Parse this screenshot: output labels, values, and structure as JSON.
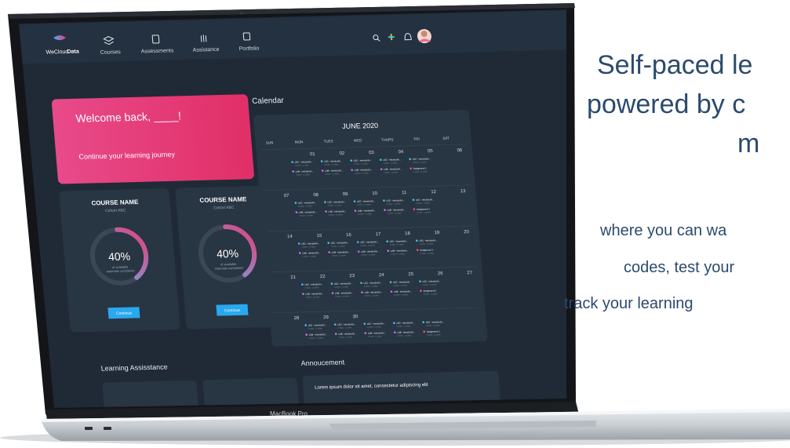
{
  "marketing": {
    "headline": [
      "Self-paced le",
      "powered by c",
      "m"
    ],
    "body": [
      "where you can wa",
      "codes, test your",
      "track your learning"
    ]
  },
  "laptop": {
    "brand_label": "MacBook Pro"
  },
  "app": {
    "logo": {
      "prefix": "WeCloud",
      "suffix": "Data"
    },
    "nav": [
      {
        "label": "Courses",
        "icon": "layers-icon"
      },
      {
        "label": "Assessments",
        "icon": "clipboard-icon"
      },
      {
        "label": "Assistance",
        "icon": "hand-icon"
      },
      {
        "label": "Portfolio",
        "icon": "portfolio-icon"
      }
    ],
    "header_icons": [
      "search-icon",
      "slack-icon",
      "bell-icon",
      "avatar"
    ],
    "welcome": {
      "title": "Welcome back, ____!",
      "subtitle": "Continue your learning journey"
    },
    "courses": [
      {
        "name": "COURSE NAME",
        "cohort": "Cohort ABC",
        "percent": "40%",
        "progress": 0.4,
        "caption_1": "of available",
        "caption_2": "materials completed",
        "button": "Continue"
      },
      {
        "name": "COURSE NAME",
        "cohort": "Cohort ABC",
        "percent": "40%",
        "progress": 0.4,
        "caption_1": "of available",
        "caption_2": "materials completed",
        "button": "Continue"
      }
    ],
    "calendar": {
      "section_title": "Calendar",
      "month": "JUNE 2020",
      "days": [
        "SUN",
        "MON",
        "TUES",
        "WED",
        "THURS",
        "FRI",
        "SAT"
      ],
      "weeks": [
        [
          "",
          "01",
          "02",
          "03",
          "04",
          "05",
          "06"
        ],
        [
          "07",
          "08",
          "09",
          "10",
          "11",
          "12",
          "13"
        ],
        [
          "14",
          "15",
          "16",
          "17",
          "18",
          "19",
          "20"
        ],
        [
          "21",
          "22",
          "23",
          "24",
          "25",
          "26",
          "27"
        ],
        [
          "28",
          "29",
          "30",
          "",
          "",
          "",
          ""
        ]
      ],
      "event_row_1": [
        "LEC - Introductio...",
        "LEC - Introductio...",
        "LEC - Introductio...",
        "LEC - Introductio...",
        "LEC - Introductio..."
      ],
      "event_row_2": [
        "LAB - Introductio...",
        "LAB - Introductio...",
        "LAB - Introductio...",
        "LAB - Introductio...",
        "Assignment 1"
      ],
      "event_time": "9:30am - 11:30am",
      "colors": {
        "lec": "#3ec6ff",
        "lab": "#d46cff",
        "assignment": "#ff4d7a"
      }
    },
    "learning_assistance": {
      "title": "Learning Assisstance"
    },
    "announcement": {
      "title": "Annoucement",
      "text": "Lorem ipsum dolor sit amet, consectetur adipiscing elit"
    }
  },
  "colors": {
    "screen_bg": "#1f2a36",
    "card_bg": "#283543",
    "accent_pink": "#e5306f",
    "button_blue": "#29a8f0",
    "headline": "#2b4a6d"
  }
}
